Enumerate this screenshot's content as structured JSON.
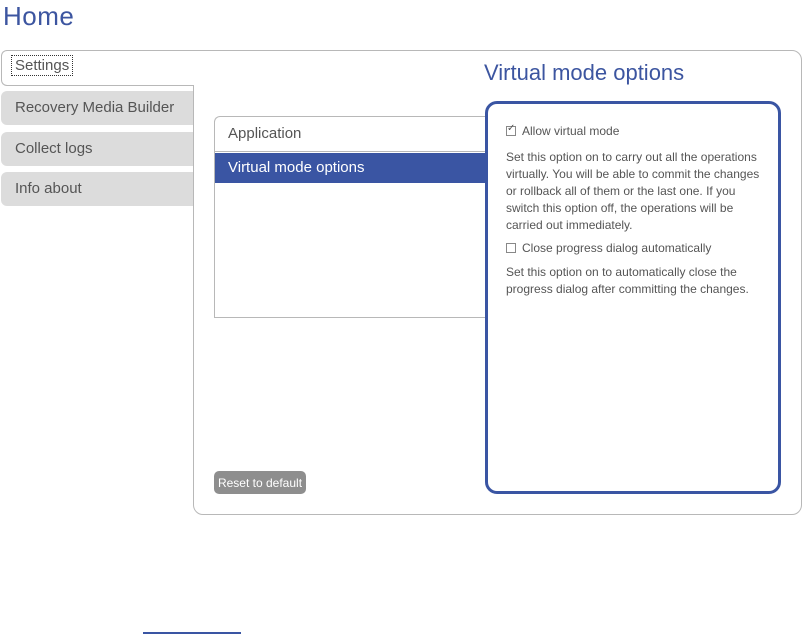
{
  "page": {
    "title": "Home"
  },
  "tabs": {
    "active": "Settings",
    "items": [
      "Recovery Media Builder",
      "Collect logs",
      "Info about"
    ]
  },
  "section_title": "Virtual mode options",
  "category_list": {
    "header": "Application",
    "selected": "Virtual mode options"
  },
  "options": {
    "allow_virtual": {
      "label": "Allow virtual mode",
      "checked": true
    },
    "allow_virtual_desc": "Set this option on to carry out all the operations virtually. You will be able to commit the changes or rollback all of them or the last one. If you switch this option off, the operations will be carried out immediately.",
    "close_progress": {
      "label": "Close progress dialog automatically",
      "checked": false
    },
    "close_progress_desc": "Set this option on to automatically close the progress dialog after committing the changes."
  },
  "buttons": {
    "reset": "Reset to default"
  },
  "colors": {
    "accent": "#3a55a3",
    "tab_bg": "#dcdcdc",
    "button_bg": "#8e8e8e"
  }
}
